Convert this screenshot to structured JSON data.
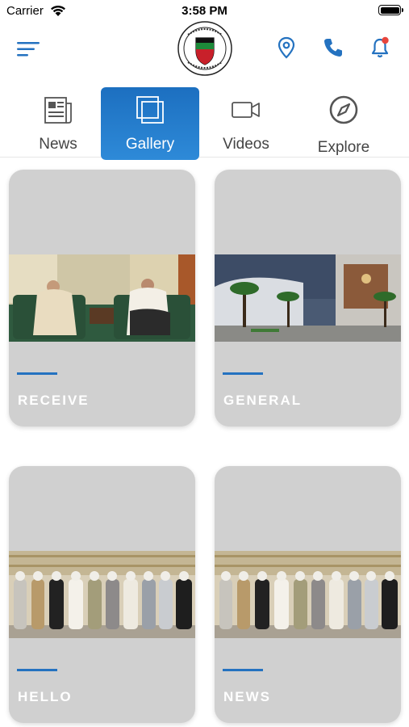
{
  "status_bar": {
    "carrier": "Carrier",
    "time": "3:58 PM"
  },
  "header": {
    "icons": [
      "menu-icon",
      "location-pin-icon",
      "phone-icon",
      "bell-icon"
    ],
    "accent_color": "#2472c0",
    "notification_dot_color": "#e8453c"
  },
  "tabs": [
    {
      "label": "News",
      "icon": "newspaper-icon",
      "active": false
    },
    {
      "label": "Gallery",
      "icon": "gallery-icon",
      "active": true
    },
    {
      "label": "Videos",
      "icon": "video-camera-icon",
      "active": false
    },
    {
      "label": "Explore",
      "icon": "compass-icon",
      "active": false
    }
  ],
  "gallery": {
    "cards": [
      {
        "title": "RECEIVE",
        "image": "two men seated on green sofas"
      },
      {
        "title": "GENERAL",
        "image": "club building with palm trees"
      },
      {
        "title": "HELLO",
        "image": "group photo of men standing"
      },
      {
        "title": "NEWS",
        "image": "group photo of men standing"
      }
    ]
  }
}
